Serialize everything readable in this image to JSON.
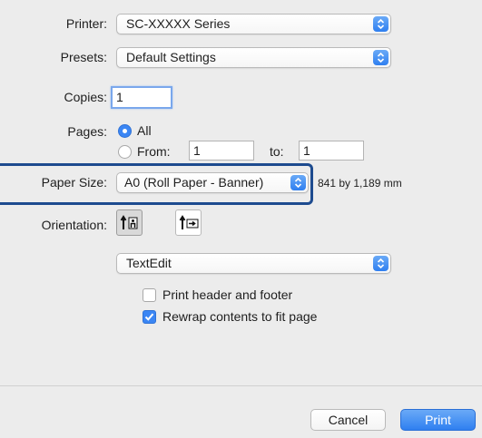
{
  "printer": {
    "label": "Printer:",
    "value": "SC-XXXXX Series"
  },
  "presets": {
    "label": "Presets:",
    "value": "Default Settings"
  },
  "copies": {
    "label": "Copies:",
    "value": "1"
  },
  "pages": {
    "label": "Pages:",
    "all_label": "All",
    "from_label": "From:",
    "from_value": "1",
    "to_label": "to:",
    "to_value": "1"
  },
  "paper_size": {
    "label": "Paper Size:",
    "value": "A0 (Roll Paper - Banner)",
    "dimensions": "841 by 1,189 mm"
  },
  "orientation": {
    "label": "Orientation:"
  },
  "app_menu": {
    "value": "TextEdit"
  },
  "options": {
    "header_footer": {
      "label": "Print header and footer",
      "checked": false
    },
    "rewrap": {
      "label": "Rewrap contents to fit page",
      "checked": true
    }
  },
  "buttons": {
    "cancel": "Cancel",
    "print": "Print"
  },
  "colors": {
    "accent": "#3b86f4",
    "highlight_border": "#1d4b8f",
    "background": "#ececec"
  },
  "icons": {
    "popup_arrows": "up-down-chevron-icon",
    "portrait": "portrait-orientation-icon",
    "landscape": "landscape-orientation-icon",
    "checkmark": "checkmark-icon"
  }
}
